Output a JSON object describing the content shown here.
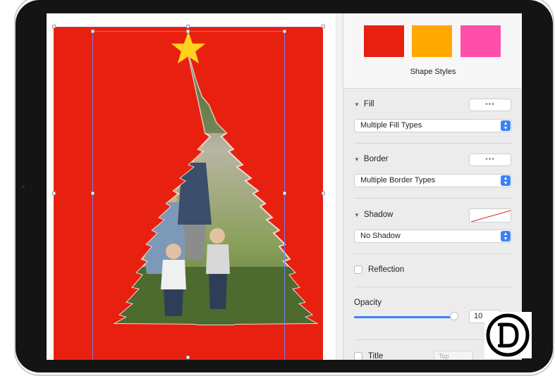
{
  "inspector": {
    "shape_styles": {
      "label": "Shape Styles",
      "swatches": [
        {
          "name": "red",
          "color": "#e8200f"
        },
        {
          "name": "orange",
          "color": "#ffa800"
        },
        {
          "name": "pink",
          "color": "#ff4fa8"
        }
      ]
    },
    "fill": {
      "title": "Fill",
      "dots": "•••",
      "select_value": "Multiple Fill Types"
    },
    "border": {
      "title": "Border",
      "dots": "•••",
      "select_value": "Multiple Border Types"
    },
    "shadow": {
      "title": "Shadow",
      "select_value": "No Shadow"
    },
    "reflection": {
      "label": "Reflection",
      "checked": false
    },
    "opacity": {
      "label": "Opacity",
      "value": "10"
    },
    "title_row": {
      "label": "Title",
      "position_placeholder": "Top"
    }
  },
  "colors": {
    "canvas_background": "#e8200f",
    "star": "#ffd21f",
    "selection": "#7a7cf0",
    "accent": "#3b82f6"
  },
  "icons": [
    "disclosure-triangle-icon",
    "popup-arrows-icon",
    "star-shape",
    "tree-mask-photo",
    "publisher-logo-icon"
  ]
}
